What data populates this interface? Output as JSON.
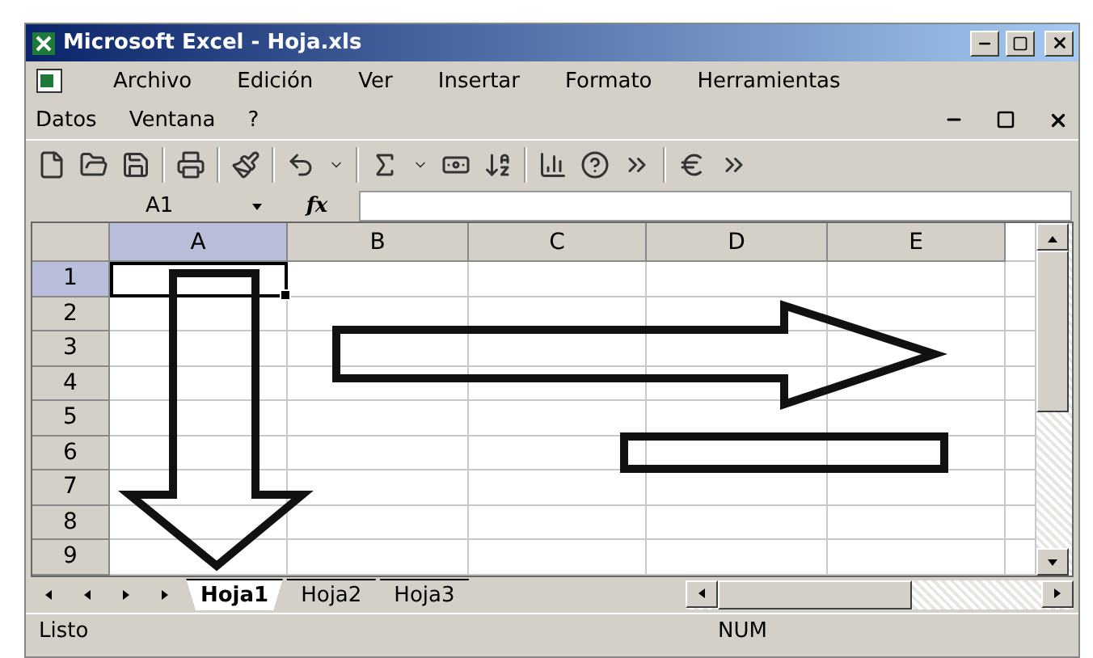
{
  "window": {
    "title": "Microsoft Excel - Hoja.xls"
  },
  "menu": {
    "rows": [
      {
        "items": [
          {
            "label": "Archivo"
          },
          {
            "label": "Edición"
          },
          {
            "label": "Ver"
          },
          {
            "label": "Insertar"
          },
          {
            "label": "Formato"
          },
          {
            "label": "Herramientas"
          }
        ]
      },
      {
        "items": [
          {
            "label": "Datos"
          },
          {
            "label": "Ventana"
          },
          {
            "label": "?"
          }
        ]
      }
    ]
  },
  "name_box": {
    "value": "A1"
  },
  "formula_bar": {
    "label": "fx"
  },
  "sheet": {
    "columns": [
      {
        "label": "A",
        "selected": true
      },
      {
        "label": "B",
        "selected": false
      },
      {
        "label": "C",
        "selected": false
      },
      {
        "label": "D",
        "selected": false
      },
      {
        "label": "E",
        "selected": false
      }
    ],
    "rows": [
      {
        "label": "1",
        "selected": true
      },
      {
        "label": "2",
        "selected": false
      },
      {
        "label": "3",
        "selected": false
      },
      {
        "label": "4",
        "selected": false
      },
      {
        "label": "5",
        "selected": false
      },
      {
        "label": "6",
        "selected": false
      },
      {
        "label": "7",
        "selected": false
      },
      {
        "label": "8",
        "selected": false
      },
      {
        "label": "9",
        "selected": false
      }
    ]
  },
  "sheet_tabs": [
    {
      "label": "Hoja1",
      "selected": true
    },
    {
      "label": "Hoja2",
      "selected": false
    },
    {
      "label": "Hoja3",
      "selected": false
    }
  ],
  "status_bar": {
    "mode": "Listo",
    "indicator": "NUM"
  }
}
